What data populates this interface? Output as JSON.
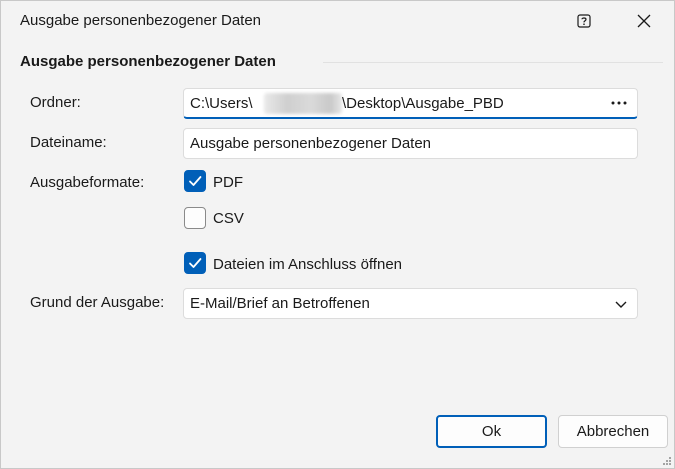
{
  "window": {
    "title": "Ausgabe personenbezogener Daten"
  },
  "section": {
    "title": "Ausgabe personenbezogener Daten"
  },
  "form": {
    "ordner": {
      "label": "Ordner:",
      "value_prefix": "C:\\Users\\",
      "value_suffix": "\\Desktop\\Ausgabe_PBD",
      "browse_label": "···"
    },
    "dateiname": {
      "label": "Dateiname:",
      "value": "Ausgabe personenbezogener Daten"
    },
    "ausgabeformate": {
      "label": "Ausgabeformate:",
      "options": [
        {
          "label": "PDF",
          "checked": true
        },
        {
          "label": "CSV",
          "checked": false
        }
      ]
    },
    "open_after": {
      "label": "Dateien im Anschluss öffnen",
      "checked": true
    },
    "grund": {
      "label": "Grund der Ausgabe:",
      "selected": "E-Mail/Brief an Betroffenen"
    }
  },
  "buttons": {
    "ok": "Ok",
    "cancel": "Abbrechen"
  },
  "colors": {
    "accent": "#005fb8",
    "background": "#f3f3f3",
    "field_bg": "#ffffff"
  },
  "icons": {
    "help": "help-icon",
    "close": "close-icon",
    "checkmark": "checkmark-icon",
    "dropdown": "chevron-down-icon",
    "resize": "resize-grip-icon"
  }
}
